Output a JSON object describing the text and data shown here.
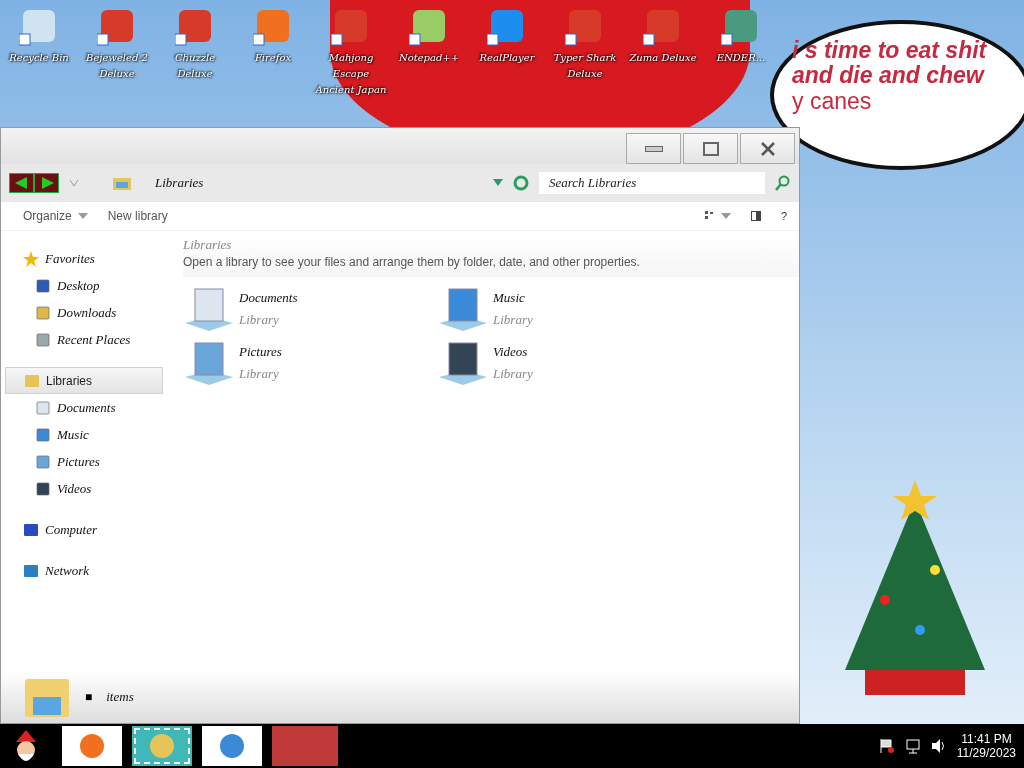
{
  "desktop_icons": [
    {
      "label": "Recycle Bin",
      "kind": "bin"
    },
    {
      "label": "Bejeweled 2 Deluxe",
      "kind": "game"
    },
    {
      "label": "Chuzzle Deluxe",
      "kind": "game"
    },
    {
      "label": "Firefox",
      "kind": "browser"
    },
    {
      "label": "Mahjong Escape Ancient Japan",
      "kind": "game"
    },
    {
      "label": "Notepad++",
      "kind": "editor"
    },
    {
      "label": "RealPlayer",
      "kind": "player"
    },
    {
      "label": "Typer Shark Deluxe",
      "kind": "game"
    },
    {
      "label": "Zuma Deluxe",
      "kind": "game"
    },
    {
      "label": "ENDER...",
      "kind": "window"
    }
  ],
  "note": {
    "lines": [
      "i s time to eat shit",
      "and die and chew",
      "y canes"
    ]
  },
  "window": {
    "address": "Libraries",
    "search": {
      "placeholder": "Search Libraries"
    },
    "toolbar": [
      {
        "label": "Organize",
        "dropdown": true
      },
      {
        "label": "New library",
        "dropdown": false
      }
    ],
    "help": "?",
    "header": {
      "title": "Libraries",
      "description": "Open a library to see your files and arrange them by folder, date, and other properties."
    },
    "libraries": [
      {
        "name": "Documents",
        "subtitle": "Library",
        "kind": "documents"
      },
      {
        "name": "Music",
        "subtitle": "Library",
        "kind": "music"
      },
      {
        "name": "Pictures",
        "subtitle": "Library",
        "kind": "pictures"
      },
      {
        "name": "Videos",
        "subtitle": "Library",
        "kind": "videos"
      }
    ],
    "sidebar": [
      {
        "label": "Favorites",
        "kind": "star",
        "selected": false,
        "children": [
          {
            "label": "Desktop",
            "kind": "desktop",
            "selected": false
          },
          {
            "label": "Downloads",
            "kind": "downloads",
            "selected": false
          },
          {
            "label": "Recent Places",
            "kind": "recent",
            "selected": false
          }
        ]
      },
      {
        "label": "Libraries",
        "kind": "library",
        "selected": true,
        "children": [
          {
            "label": "Documents",
            "kind": "documents",
            "selected": false
          },
          {
            "label": "Music",
            "kind": "music",
            "selected": false
          },
          {
            "label": "Pictures",
            "kind": "pictures",
            "selected": false
          },
          {
            "label": "Videos",
            "kind": "videos",
            "selected": false
          }
        ]
      },
      {
        "label": "Computer",
        "kind": "computer",
        "selected": false
      },
      {
        "label": "Network",
        "kind": "network",
        "selected": false
      }
    ],
    "status": {
      "count": "■",
      "label": "items"
    }
  },
  "taskbar": {
    "apps": [
      {
        "kind": "browser",
        "selected": false
      },
      {
        "kind": "explorer",
        "selected": true
      },
      {
        "kind": "chrome",
        "selected": false
      },
      {
        "kind": "blank",
        "selected": false
      }
    ],
    "time": "11:41 PM",
    "date": "11/29/2023"
  }
}
